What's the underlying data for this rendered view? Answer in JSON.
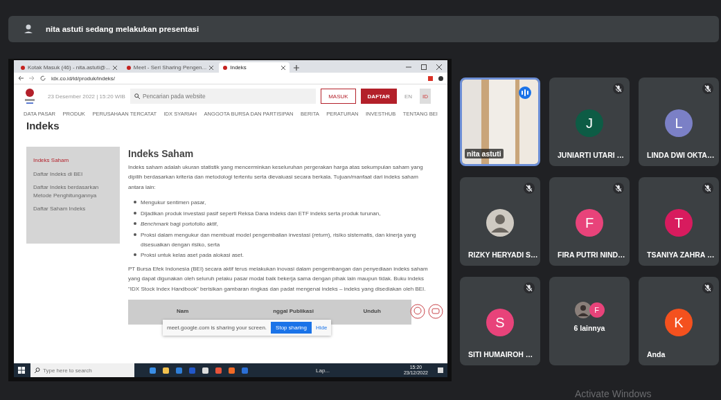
{
  "presenting_banner": {
    "text": "nita astuti sedang melakukan presentasi"
  },
  "shared_screen": {
    "browser_tabs": [
      {
        "label": "Kotak Masuk (46) - nita.astuti@...",
        "selected": false
      },
      {
        "label": "Meet - Seri Sharing Pengen...",
        "selected": false
      },
      {
        "label": "Indeks",
        "selected": true
      }
    ],
    "address": "idx.co.id/id/produk/indeks/",
    "site_date": "23 Desember 2022  |  15:20 WIB",
    "search": {
      "placeholder": "Pencarian pada website"
    },
    "login_button": "MASUK",
    "register_button": "DAFTAR",
    "languages": [
      {
        "label": "EN",
        "selected": false
      },
      {
        "label": "ID",
        "selected": true
      }
    ],
    "nav": [
      "DATA PASAR",
      "PRODUK",
      "PERUSAHAAN TERCATAT",
      "IDX SYARIAH",
      "ANGGOTA BURSA DAN PARTISIPAN",
      "BERITA",
      "PERATURAN",
      "INVESTHUB",
      "TENTANG BEI"
    ],
    "page_title": "Indeks",
    "side_menu": [
      {
        "label": "Indeks Saham",
        "selected": true
      },
      {
        "label": "Daftar Indeks di BEI",
        "selected": false
      },
      {
        "label": "Daftar Indeks berdasarkan Metode Penghitungannya",
        "selected": false
      },
      {
        "label": "Daftar Saham Indeks",
        "selected": false
      }
    ],
    "heading": "Indeks Saham",
    "intro": "Indeks saham adalah ukuran statistik yang mencerminkan keseluruhan pergerakan harga atas sekumpulan saham yang dipilih berdasarkan kriteria dan metodologi tertentu serta dievaluasi secara berkala. Tujuan/manfaat dari indeks saham antara lain:",
    "bullets": [
      "Mengukur sentimen pasar,",
      "Dijadikan produk investasi pasif seperti Reksa Dana indeks dan ETF indeks serta produk turunan,",
      "*Benchmark* bagi portofolio aktif,",
      "Proksi dalam mengukur dan membuat model pengembalian investasi (*return*), risiko sistematis, dan kinerja yang disesuaikan dengan risiko, serta",
      "Proksi untuk kelas aset pada alokasi aset."
    ],
    "body": "PT Bursa Efek Indonesia (BEI) secara aktif terus melakukan inovasi dalam pengembangan dan penyediaan indeks saham yang dapat digunakan oleh seluruh pelaku pasar modal baik bekerja sama dengan pihak lain maupun tidak. Buku indeks \"IDX Stock Index Handbook\" berisikan gambaran ringkas dan padat mengenai indeks – indeks yang disediakan oleh BEI.",
    "table_columns": [
      "Nam",
      "nggal Publikasi",
      "Unduh"
    ],
    "sharing_bar": {
      "text": "meet.google.com is sharing your screen.",
      "stop_button": "Stop sharing",
      "hide_link": "Hide"
    },
    "taskbar": {
      "search_placeholder": "Type here to search",
      "app_label": "Lap...",
      "time": "15:20",
      "date": "23/12/2022"
    }
  },
  "tiles": [
    {
      "kind": "video",
      "name": "nita astuti",
      "muted": false,
      "speaking": true
    },
    {
      "kind": "avatar",
      "name": "JUNIARTI UTARI …",
      "initial": "J",
      "color": "#0d5c45",
      "muted": true,
      "speaking": false
    },
    {
      "kind": "avatar",
      "name": "LINDA DWI OKTA…",
      "initial": "L",
      "color": "#7b80c6",
      "muted": true,
      "speaking": false
    },
    {
      "kind": "photo",
      "name": "RIZKY HERYADI S…",
      "muted": true,
      "speaking": false
    },
    {
      "kind": "avatar",
      "name": "FIRA PUTRI NIND…",
      "initial": "F",
      "color": "#e8437a",
      "muted": true,
      "speaking": false
    },
    {
      "kind": "avatar",
      "name": "TSANIYA ZAHRA …",
      "initial": "T",
      "color": "#d81b5e",
      "muted": true,
      "speaking": false
    },
    {
      "kind": "avatar",
      "name": "SITI HUMAIROH …",
      "initial": "S",
      "color": "#e8437a",
      "muted": true,
      "speaking": false
    },
    {
      "kind": "overflow",
      "name": "6 lainnya",
      "initial": "F",
      "color": "#e8437a",
      "muted": false,
      "speaking": false
    },
    {
      "kind": "avatar",
      "name": "Anda",
      "initial": "K",
      "color": "#f4511e",
      "muted": true,
      "speaking": false
    }
  ],
  "os_notice": "Activate Windows"
}
